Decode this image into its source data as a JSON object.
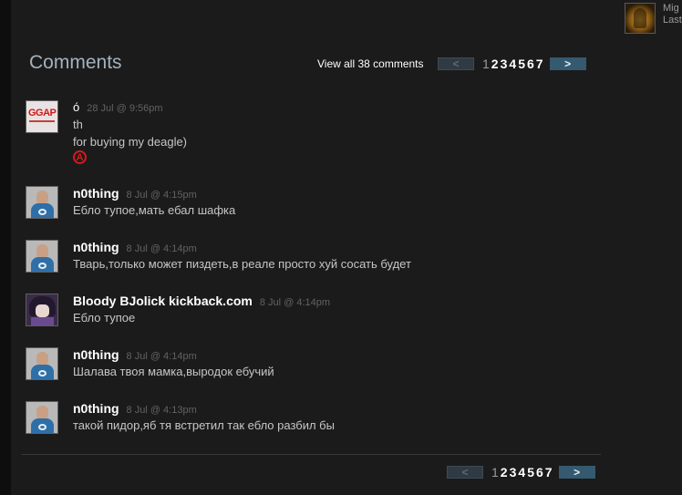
{
  "corner": {
    "name": "Mig",
    "status": "Last"
  },
  "comments_section": {
    "title": "Comments",
    "view_all": "View all 38 comments",
    "pager": {
      "prev": "<",
      "next": ">",
      "pages": [
        "1",
        "2",
        "3",
        "4",
        "5",
        "6",
        "7"
      ],
      "current": "1"
    }
  },
  "comments": [
    {
      "author": "ó",
      "timestamp": "28 Jul @ 9:56pm",
      "lines": [
        "th",
        "for buying my deagle)"
      ],
      "symbol": "A",
      "avatar": "ggap-logo",
      "avatar_text": "GGAP"
    },
    {
      "author": "n0thing",
      "timestamp": "8 Jul @ 4:15pm",
      "lines": [
        "Ебло тупое,мать ебал шафка"
      ],
      "avatar": "person"
    },
    {
      "author": "n0thing",
      "timestamp": "8 Jul @ 4:14pm",
      "lines": [
        "Тварь,только может пиздеть,в реале просто хуй сосать будет"
      ],
      "avatar": "person"
    },
    {
      "author": "Bloody BJolick kickback.com",
      "timestamp": "8 Jul @ 4:14pm",
      "lines": [
        "Ебло тупое"
      ],
      "avatar": "anime"
    },
    {
      "author": "n0thing",
      "timestamp": "8 Jul @ 4:14pm",
      "lines": [
        "Шалава твоя мамка,выродок ебучий"
      ],
      "avatar": "person"
    },
    {
      "author": "n0thing",
      "timestamp": "8 Jul @ 4:13pm",
      "lines": [
        "такой пидор,яб тя встретил так ебло разбил бы"
      ],
      "avatar": "person"
    }
  ],
  "colors": {
    "background": "#1b1b1b",
    "title": "#a4b2be",
    "next_button": "#35596f",
    "anarchy": "#d51b1b"
  }
}
